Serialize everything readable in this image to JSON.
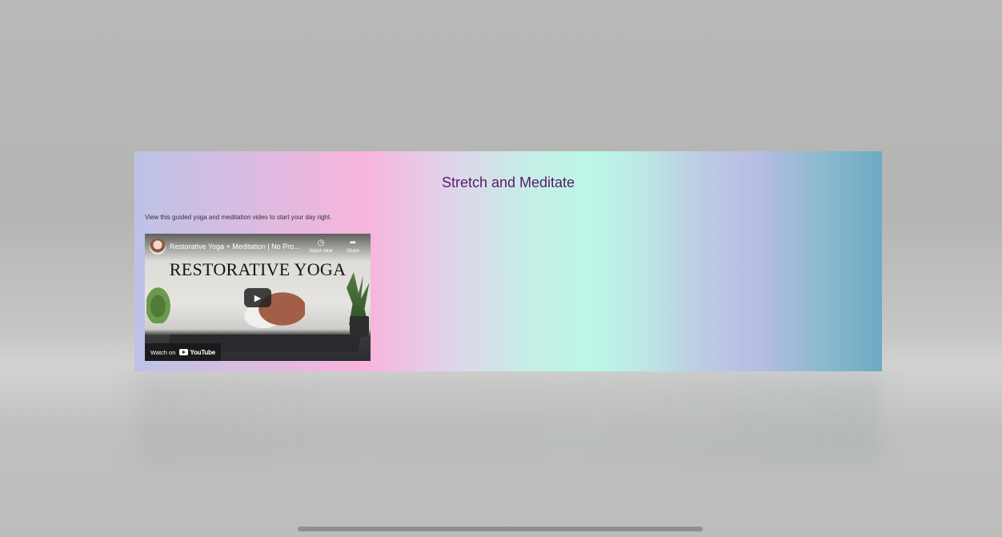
{
  "card": {
    "title": "Stretch and Meditate",
    "description": "View this guided yoga and meditation video to start your day right."
  },
  "video": {
    "title": "Restorative Yoga + Meditation | No Pro...",
    "headline": "RESTORATIVE YOGA",
    "watch_later_label": "Watch later",
    "share_label": "Share",
    "watch_on_label": "Watch on",
    "brand": "YouTube",
    "icons": {
      "watch_later": "clock-icon",
      "share": "share-arrow-icon",
      "play": "play-icon"
    }
  },
  "colors": {
    "title": "#5a1a66",
    "accent_pink": "#f8b4dc",
    "accent_mint": "#bbf7e7",
    "accent_teal": "#6cabc2"
  }
}
